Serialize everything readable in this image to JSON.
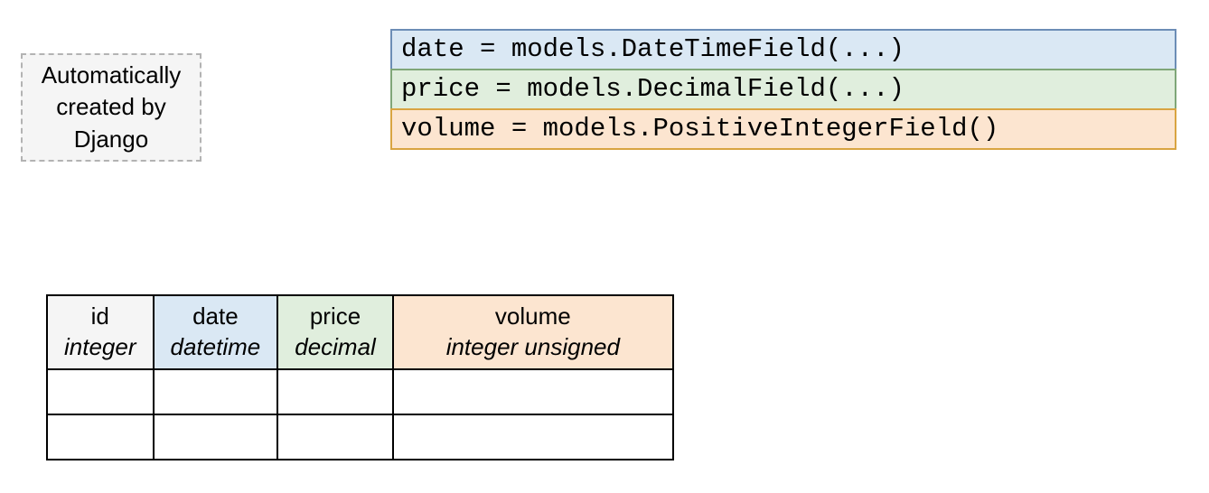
{
  "callout": {
    "text": "Automatically created by Django"
  },
  "code_lines": [
    "date = models.DateTimeField(...)",
    "price = models.DecimalField(...)",
    "volume = models.PositiveIntegerField()"
  ],
  "table": {
    "columns": [
      {
        "name": "id",
        "type": "integer"
      },
      {
        "name": "date",
        "type": "datetime"
      },
      {
        "name": "price",
        "type": "decimal"
      },
      {
        "name": "volume",
        "type": "integer unsigned"
      }
    ]
  }
}
